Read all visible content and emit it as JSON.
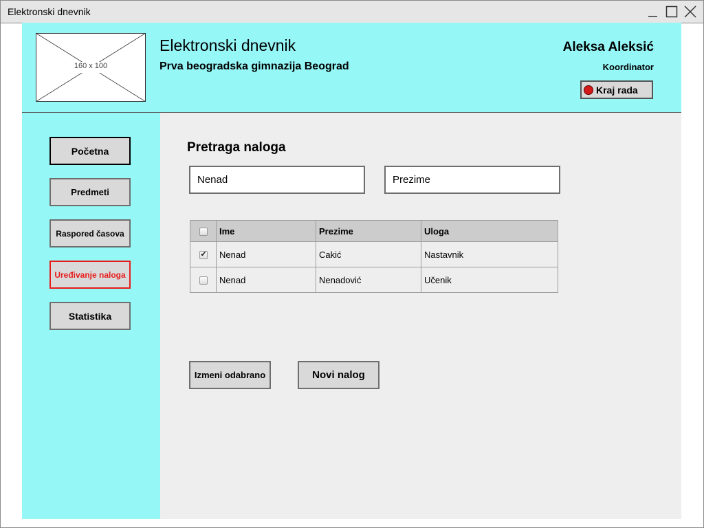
{
  "window": {
    "title": "Elektronski dnevnik"
  },
  "header": {
    "logo_placeholder": "160 x 100",
    "app_title": "Elektronski dnevnik",
    "school": "Prva beogradska gimnazija Beograd",
    "user_name": "Aleksa Aleksić",
    "user_role": "Koordinator",
    "logout_label": "Kraj rada",
    "background_color": "#96f7f7"
  },
  "sidebar": {
    "items": [
      {
        "label": "Početna",
        "state": "active"
      },
      {
        "label": "Predmeti",
        "state": "normal"
      },
      {
        "label": "Raspored časova",
        "state": "normal"
      },
      {
        "label": "Uređivanje naloga",
        "state": "selected"
      },
      {
        "label": "Statistika",
        "state": "normal"
      }
    ],
    "selected_color": "#e81b1b"
  },
  "main": {
    "section_title": "Pretraga naloga",
    "search": {
      "first_name_value": "Nenad",
      "last_name_value": "Prezime"
    },
    "table": {
      "columns": [
        "Ime",
        "Prezime",
        "Uloga"
      ],
      "rows": [
        {
          "checked": true,
          "ime": "Nenad",
          "prezime": "Cakić",
          "uloga": "Nastavnik"
        },
        {
          "checked": false,
          "ime": "Nenad",
          "prezime": "Nenadović",
          "uloga": "Učenik"
        }
      ]
    },
    "buttons": {
      "edit_selected": "Izmeni odabrano",
      "new_account": "Novi nalog"
    }
  }
}
